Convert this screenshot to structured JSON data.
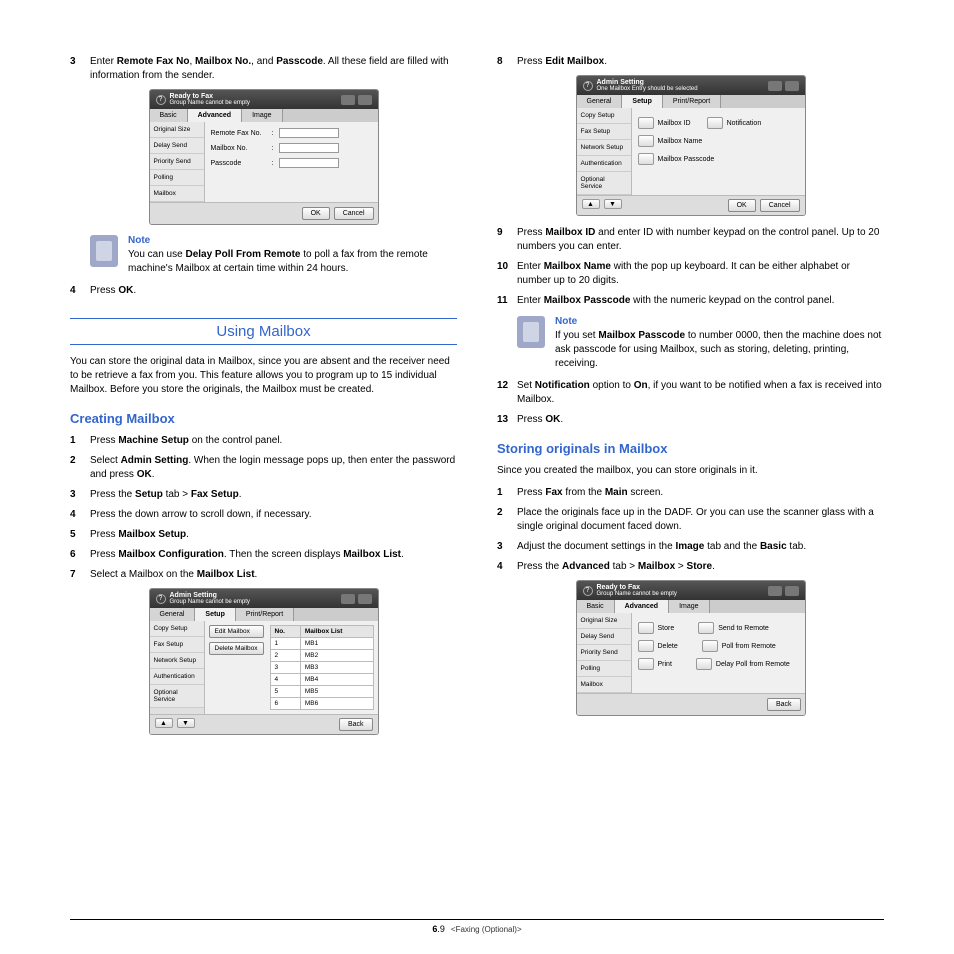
{
  "left": {
    "step3": {
      "num": "3",
      "t1": "Enter ",
      "b1": "Remote Fax No",
      "t2": ", ",
      "b2": "Mailbox No.",
      "t3": ", and ",
      "b3": "Passcode",
      "t4": ". All these field are filled with information from the sender."
    },
    "shot1": {
      "header1": "Ready to Fax",
      "header2": "Group Name cannot be empty",
      "tab1": "Basic",
      "tab2": "Advanced",
      "tab3": "Image",
      "side": [
        "Original Size",
        "Delay Send",
        "Priority Send",
        "Polling",
        "Mailbox"
      ],
      "row1": "Remote Fax No.",
      "row2": "Mailbox No.",
      "row3": "Passcode",
      "ok": "OK",
      "cancel": "Cancel"
    },
    "note1": {
      "label": "Note",
      "t1": "You can use ",
      "b1": "Delay Poll From Remote",
      "t2": " to poll a fax from the remote machine's Mailbox at certain time within 24 hours."
    },
    "step4": {
      "num": "4",
      "t1": "Press ",
      "b1": "OK",
      "t2": "."
    },
    "title_using": "Using Mailbox",
    "using_para": "You can store the original data in Mailbox, since you are absent and the receiver need to be retrieve a fax from you. This feature allows you to program up to 15 individual Mailbox. Before you store the originals, the Mailbox must be created.",
    "title_creating": "Creating Mailbox",
    "c1": {
      "num": "1",
      "t1": "Press ",
      "b1": "Machine Setup",
      "t2": " on the control panel."
    },
    "c2": {
      "num": "2",
      "t1": "Select ",
      "b1": "Admin Setting",
      "t2": ". When the login message pops up, then enter the password and press ",
      "b2": "OK",
      "t3": "."
    },
    "c3": {
      "num": "3",
      "t1": "Press the ",
      "b1": "Setup",
      "t2": " tab > ",
      "b2": "Fax Setup",
      "t3": "."
    },
    "c4": {
      "num": "4",
      "t1": "Press the down arrow to scroll down, if necessary."
    },
    "c5": {
      "num": "5",
      "t1": "Press ",
      "b1": "Mailbox Setup",
      "t2": "."
    },
    "c6": {
      "num": "6",
      "t1": "Press ",
      "b1": "Mailbox Configuration",
      "t2": ". Then the screen displays ",
      "b2": "Mailbox List",
      "t3": "."
    },
    "c7": {
      "num": "7",
      "t1": "Select a Mailbox on the ",
      "b1": "Mailbox List",
      "t2": "."
    },
    "shot2": {
      "header1": "Admin Setting",
      "header2": "Group Name cannot be empty",
      "tab1": "General",
      "tab2": "Setup",
      "tab3": "Print/Report",
      "side": [
        "Copy Setup",
        "Fax Setup",
        "Network Setup",
        "Authentication",
        "Optional Service"
      ],
      "btn1": "Edit Mailbox",
      "btn2": "Delete Mailbox",
      "thNo": "No.",
      "thList": "Mailbox List",
      "rows": [
        [
          "1",
          "MB1"
        ],
        [
          "2",
          "MB2"
        ],
        [
          "3",
          "MB3"
        ],
        [
          "4",
          "MB4"
        ],
        [
          "5",
          "MB5"
        ],
        [
          "6",
          "MB6"
        ]
      ],
      "back": "Back"
    }
  },
  "right": {
    "s8": {
      "num": "8",
      "t1": "Press ",
      "b1": "Edit Mailbox",
      "t2": "."
    },
    "shot3": {
      "header1": "Admin Setting",
      "header2": "One Mailbox Entry should be selected",
      "tab1": "General",
      "tab2": "Setup",
      "tab3": "Print/Report",
      "side": [
        "Copy Setup",
        "Fax Setup",
        "Network Setup",
        "Authentication",
        "Optional Service"
      ],
      "r1": "Mailbox ID",
      "r1b": "Notification",
      "r2": "Mailbox Name",
      "r3": "Mailbox Passcode",
      "ok": "OK",
      "cancel": "Cancel"
    },
    "s9": {
      "num": "9",
      "t1": "Press ",
      "b1": "Mailbox ID",
      "t2": " and enter ID with number keypad on the control panel. Up to 20 numbers you can enter."
    },
    "s10": {
      "num": "10",
      "t1": "Enter ",
      "b1": "Mailbox Name",
      "t2": " with the pop up keyboard. It can be either alphabet or number up to 20 digits."
    },
    "s11": {
      "num": "11",
      "t1": "Enter ",
      "b1": "Mailbox Passcode",
      "t2": " with the numeric keypad on the control panel."
    },
    "note2": {
      "label": "Note",
      "t1": "If you set ",
      "b1": "Mailbox Passcode",
      "t2": " to number 0000, then the machine does not ask passcode for using Mailbox, such as storing, deleting, printing, receiving."
    },
    "s12": {
      "num": "12",
      "t1": "Set ",
      "b1": "Notification",
      "t2": " option to ",
      "b2": "On",
      "t3": ", if you want to be notified when a fax is received into Mailbox."
    },
    "s13": {
      "num": "13",
      "t1": "Press ",
      "b1": "OK",
      "t2": "."
    },
    "title_storing": "Storing originals in Mailbox",
    "storing_para": "Since you created the mailbox, you can store originals in it.",
    "st1": {
      "num": "1",
      "t1": "Press ",
      "b1": "Fax",
      "t2": " from the ",
      "b2": "Main",
      "t3": " screen."
    },
    "st2": {
      "num": "2",
      "t1": "Place the originals face up in the DADF. Or you can use the scanner glass with a single original document faced down."
    },
    "st3": {
      "num": "3",
      "t1": "Adjust the document settings in the ",
      "b1": "Image",
      "t2": " tab and the ",
      "b2": "Basic",
      "t3": " tab."
    },
    "st4": {
      "num": "4",
      "t1": "Press the ",
      "b1": "Advanced",
      "t2": " tab > ",
      "b2": "Mailbox",
      "t3": " > ",
      "b3": "Store",
      "t4": "."
    },
    "shot4": {
      "header1": "Ready to Fax",
      "header2": "Group Name cannot be empty",
      "tab1": "Basic",
      "tab2": "Advanced",
      "tab3": "Image",
      "side": [
        "Original Size",
        "Delay Send",
        "Priority Send",
        "Polling",
        "Mailbox"
      ],
      "opts": [
        [
          "Store",
          "Send to Remote"
        ],
        [
          "Delete",
          "Poll from Remote"
        ],
        [
          "Print",
          "Delay Poll from Remote"
        ]
      ],
      "back": "Back"
    }
  },
  "footer": {
    "page": "6",
    "sub": ".9",
    "chap": "<Faxing (Optional)>"
  }
}
